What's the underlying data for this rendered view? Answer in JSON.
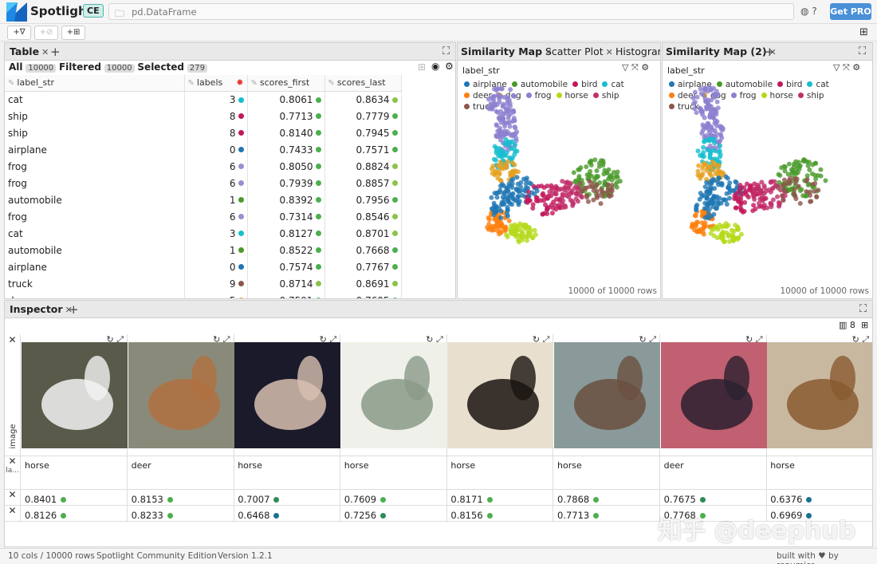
{
  "app": {
    "title": "Spotlight",
    "edition_badge": "CE",
    "dataframe": "pd.DataFrame",
    "get_pro": "Get PRO"
  },
  "toolbar": {
    "add_filter": "+∇",
    "add_tag": "+⊘",
    "add_group": "+⊞"
  },
  "table_panel": {
    "tab": "Table",
    "counts": {
      "all_label": "All",
      "all": "10000",
      "filtered_label": "Filtered",
      "filtered": "10000",
      "selected_label": "Selected",
      "selected": "279"
    },
    "columns": [
      "label_str",
      "labels",
      "scores_first",
      "scores_last"
    ],
    "rows": [
      {
        "label": "cat",
        "labels": "3",
        "first": "0.8061",
        "last": "0.8634",
        "lc": "#17becf",
        "fc": "#4caf50",
        "sc": "#8bc34a"
      },
      {
        "label": "ship",
        "labels": "8",
        "first": "0.7713",
        "last": "0.7779",
        "lc": "#c2185b",
        "fc": "#4caf50",
        "sc": "#4caf50"
      },
      {
        "label": "ship",
        "labels": "8",
        "first": "0.8140",
        "last": "0.7945",
        "lc": "#c2185b",
        "fc": "#4caf50",
        "sc": "#4caf50"
      },
      {
        "label": "airplane",
        "labels": "0",
        "first": "0.7433",
        "last": "0.7571",
        "lc": "#1f77b4",
        "fc": "#4caf50",
        "sc": "#4caf50"
      },
      {
        "label": "frog",
        "labels": "6",
        "first": "0.8050",
        "last": "0.8824",
        "lc": "#9a8fd0",
        "fc": "#4caf50",
        "sc": "#8bc34a"
      },
      {
        "label": "frog",
        "labels": "6",
        "first": "0.7939",
        "last": "0.8857",
        "lc": "#9a8fd0",
        "fc": "#4caf50",
        "sc": "#8bc34a"
      },
      {
        "label": "automobile",
        "labels": "1",
        "first": "0.8392",
        "last": "0.7956",
        "lc": "#4a9a2a",
        "fc": "#4caf50",
        "sc": "#4caf50"
      },
      {
        "label": "frog",
        "labels": "6",
        "first": "0.7314",
        "last": "0.8546",
        "lc": "#9a8fd0",
        "fc": "#4caf50",
        "sc": "#8bc34a"
      },
      {
        "label": "cat",
        "labels": "3",
        "first": "0.8127",
        "last": "0.8701",
        "lc": "#17becf",
        "fc": "#4caf50",
        "sc": "#8bc34a"
      },
      {
        "label": "automobile",
        "labels": "1",
        "first": "0.8522",
        "last": "0.7668",
        "lc": "#4a9a2a",
        "fc": "#4caf50",
        "sc": "#4caf50"
      },
      {
        "label": "airplane",
        "labels": "0",
        "first": "0.7574",
        "last": "0.7767",
        "lc": "#1f77b4",
        "fc": "#4caf50",
        "sc": "#4caf50"
      },
      {
        "label": "truck",
        "labels": "9",
        "first": "0.8714",
        "last": "0.8691",
        "lc": "#8c564b",
        "fc": "#8bc34a",
        "sc": "#8bc34a"
      },
      {
        "label": "dog",
        "labels": "5",
        "first": "0.7591",
        "last": "0.7605",
        "lc": "#e6a020",
        "fc": "#4caf50",
        "sc": "#4caf50"
      }
    ]
  },
  "view_tabs": {
    "similarity_map": "Similarity Map",
    "scatter_plot": "Scatter Plot",
    "histogram": "Histogram",
    "similarity_map_2": "Similarity Map (2)"
  },
  "maps": {
    "color_by": "label_str",
    "row_count": "10000 of 10000 rows",
    "legend": [
      {
        "name": "airplane",
        "color": "#1f77b4"
      },
      {
        "name": "automobile",
        "color": "#4a9a2a"
      },
      {
        "name": "bird",
        "color": "#c2185b"
      },
      {
        "name": "cat",
        "color": "#17becf"
      },
      {
        "name": "deer",
        "color": "#ff7f0e"
      },
      {
        "name": "dog",
        "color": "#e6a020"
      },
      {
        "name": "frog",
        "color": "#8c80d0"
      },
      {
        "name": "horse",
        "color": "#b5d91a"
      },
      {
        "name": "ship",
        "color": "#c0306a"
      },
      {
        "name": "truck",
        "color": "#8c564b"
      }
    ]
  },
  "inspector": {
    "tab": "Inspector",
    "column_count": "8",
    "row_labels": {
      "image": "image",
      "label": "la..."
    },
    "cards": [
      {
        "label": "horse",
        "s1": "0.8401",
        "s2": "0.8126",
        "c1": "#4caf50",
        "c2": "#4caf50",
        "bg": "#5a5a4a",
        "fg": "#f2f2f2"
      },
      {
        "label": "deer",
        "s1": "0.8153",
        "s2": "0.8233",
        "c1": "#4caf50",
        "c2": "#4caf50",
        "bg": "#8a8a7a",
        "fg": "#b07040"
      },
      {
        "label": "horse",
        "s1": "0.7007",
        "s2": "0.6468",
        "c1": "#2e8b57",
        "c2": "#1e7090",
        "bg": "#1a1a2a",
        "fg": "#d8c0b0"
      },
      {
        "label": "horse",
        "s1": "0.7609",
        "s2": "0.7256",
        "c1": "#4caf50",
        "c2": "#2e8b57",
        "bg": "#f0f0ea",
        "fg": "#8a9a88"
      },
      {
        "label": "horse",
        "s1": "0.8171",
        "s2": "0.8156",
        "c1": "#4caf50",
        "c2": "#4caf50",
        "bg": "#e8dfcf",
        "fg": "#1a1410"
      },
      {
        "label": "horse",
        "s1": "0.7868",
        "s2": "0.7713",
        "c1": "#4caf50",
        "c2": "#4caf50",
        "bg": "#8a9a9a",
        "fg": "#6a5040"
      },
      {
        "label": "deer",
        "s1": "0.7675",
        "s2": "0.7768",
        "c1": "#2e8b57",
        "c2": "#4caf50",
        "bg": "#c06070",
        "fg": "#2a2030"
      },
      {
        "label": "horse",
        "s1": "0.6376",
        "s2": "0.6969",
        "c1": "#1e7090",
        "c2": "#1e7090",
        "bg": "#c8b8a0",
        "fg": "#8a5a30"
      }
    ]
  },
  "status": {
    "cols_rows": "10 cols / 10000 rows",
    "edition": "Spotlight Community Edition",
    "version": "Version 1.2.1",
    "built_with": "built with ♥ by renumics"
  },
  "watermark": "知乎 @deephub"
}
